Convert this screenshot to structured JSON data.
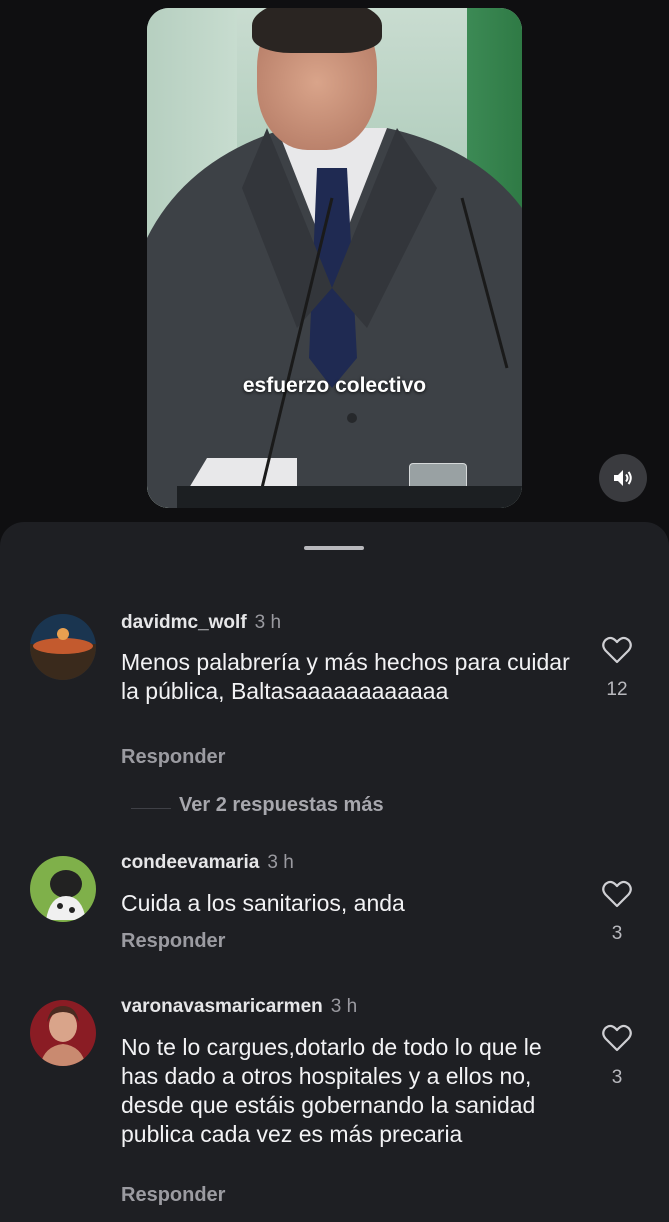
{
  "video": {
    "caption": "esfuerzo colectivo",
    "sound_icon": "speaker-icon"
  },
  "comments": [
    {
      "username": "davidmc_wolf",
      "time": "3 h",
      "text": "Menos palabrería y más hechos para cuidar la pública, Baltasaaaaaaaaaaaa",
      "reply_label": "Responder",
      "likes": "12",
      "avatar_colors": [
        "#1a3550",
        "#c35a2e",
        "#3a2a1c"
      ]
    },
    {
      "username": "condeevamaria",
      "time": "3 h",
      "text": "Cuida a los sanitarios, anda",
      "reply_label": "Responder",
      "likes": "3",
      "avatar_colors": [
        "#7fb04a",
        "#222222",
        "#f0f0f0"
      ]
    },
    {
      "username": "varonavasmaricarmen",
      "time": "3 h",
      "text": "No te lo cargues,dotarlo de todo lo que le has dado a otros hospitales y a ellos no, desde que estáis gobernando la sanidad publica cada vez es más precaria",
      "reply_label": "Responder",
      "likes": "3",
      "avatar_colors": [
        "#8a1c24",
        "#d9a48a",
        "#4a2a20"
      ]
    }
  ],
  "more_replies_label": "Ver 2 respuestas más"
}
